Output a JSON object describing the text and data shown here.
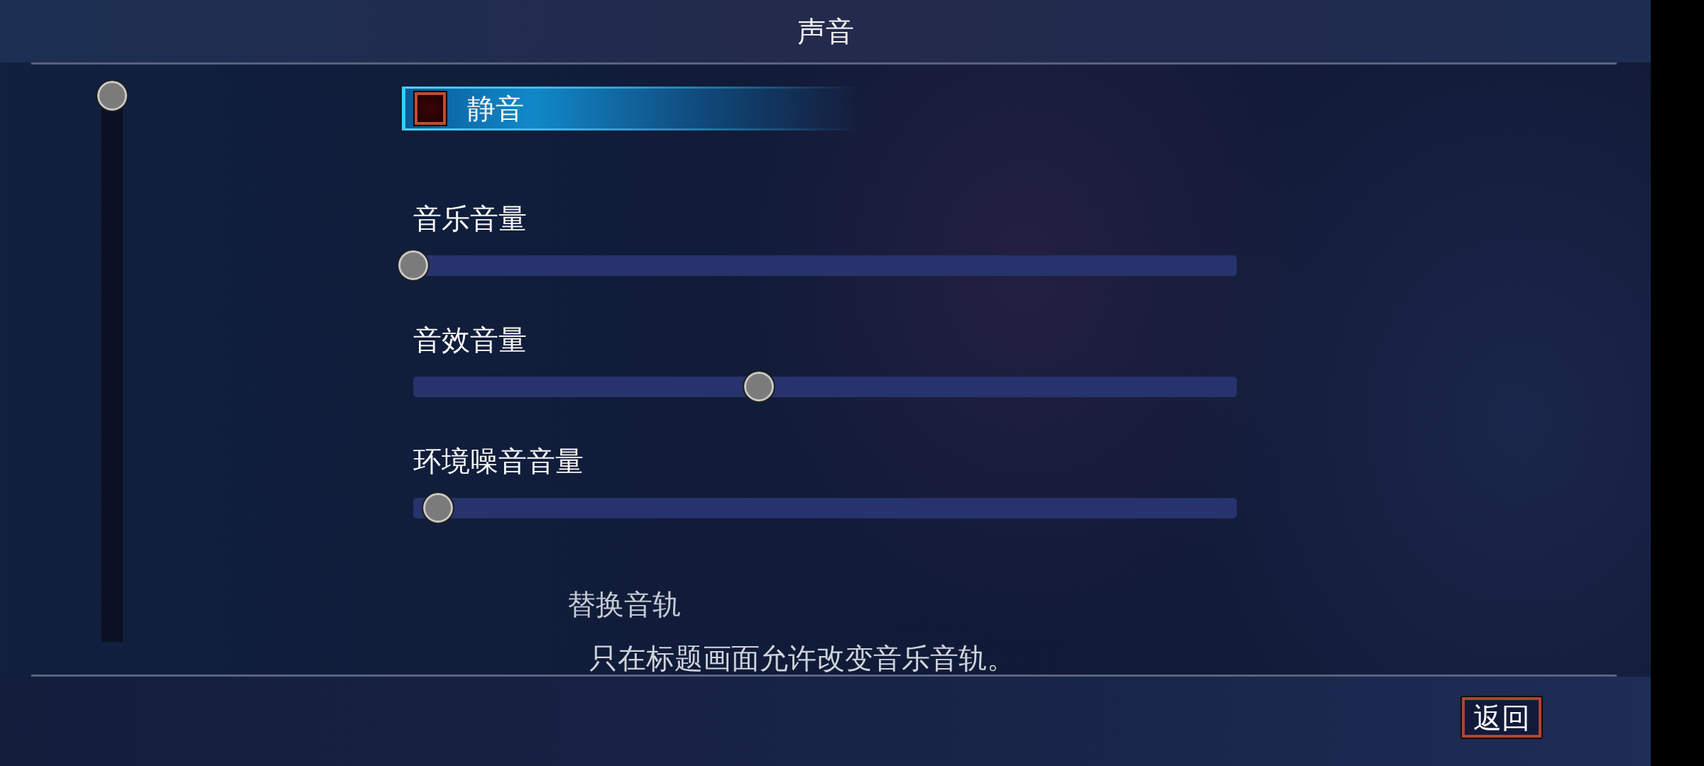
{
  "header": {
    "title": "声音"
  },
  "settings": [
    {
      "kind": "checkbox",
      "label": "静音",
      "checked": false,
      "selected": true,
      "disabled": false
    },
    {
      "kind": "slider",
      "label": "音乐音量",
      "level": 0,
      "selected": false,
      "disabled": false
    },
    {
      "kind": "slider",
      "label": "音效音量",
      "level": 0.42,
      "selected": false,
      "disabled": false
    },
    {
      "kind": "slider",
      "label": "环境噪音音量",
      "level": 0.03,
      "selected": false,
      "disabled": false
    },
    {
      "kind": "option",
      "label": "替换音轨",
      "note": "只在标题画面允许改变音乐音轨。",
      "selected": false,
      "disabled": true
    }
  ],
  "footer": {
    "buttons": [
      {
        "label": "返回"
      }
    ]
  }
}
